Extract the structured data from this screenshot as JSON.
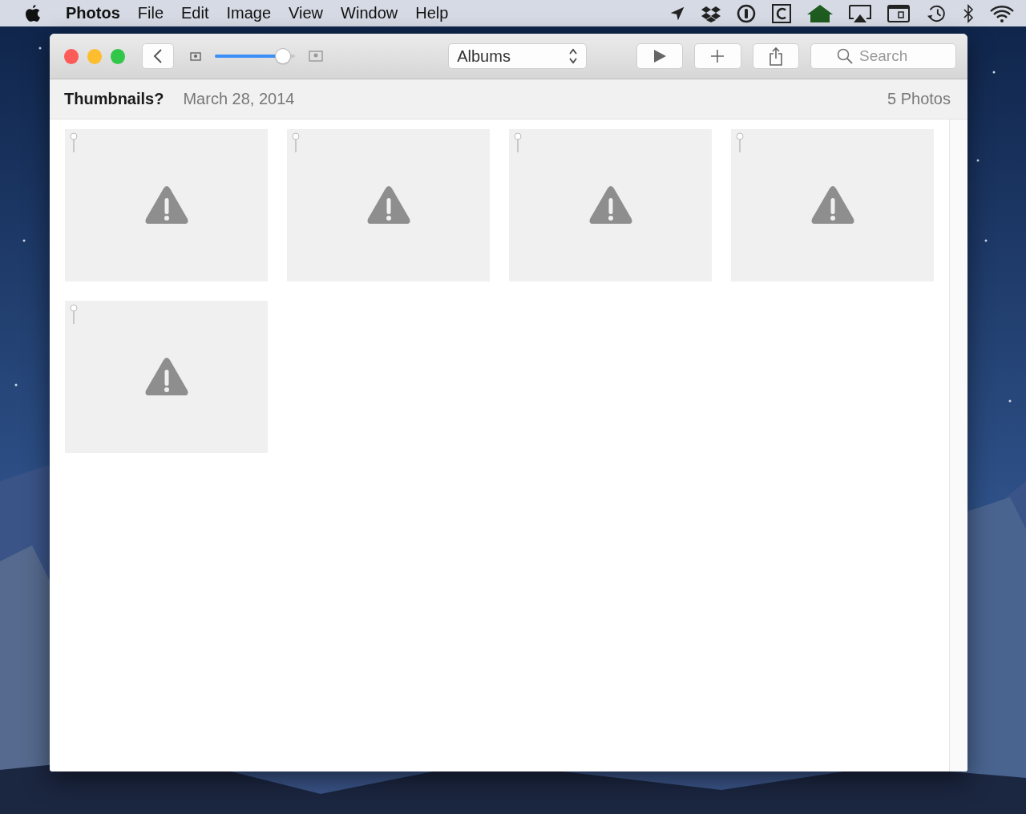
{
  "menu_bar": {
    "app_name": "Photos",
    "items": [
      "File",
      "Edit",
      "Image",
      "View",
      "Window",
      "Help"
    ]
  },
  "toolbar": {
    "zoom_slider": {
      "level": 0.85
    },
    "album_selector": {
      "value": "Albums"
    },
    "search": {
      "placeholder": "Search"
    }
  },
  "header": {
    "title": "Thumbnails?",
    "date": "March 28, 2014",
    "count": "5 Photos"
  },
  "photos": [
    {
      "kind": "missing"
    },
    {
      "kind": "missing"
    },
    {
      "kind": "missing"
    },
    {
      "kind": "missing"
    },
    {
      "kind": "missing"
    }
  ]
}
